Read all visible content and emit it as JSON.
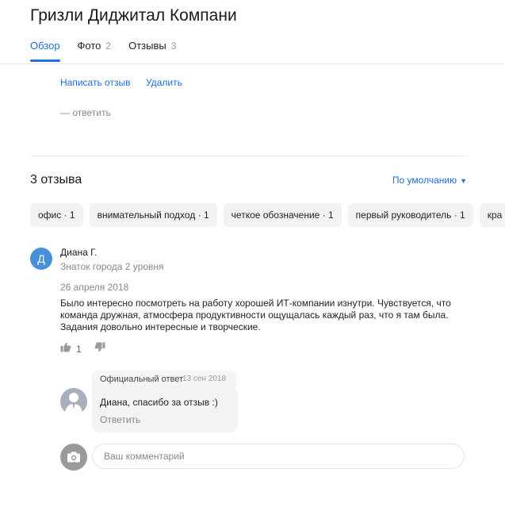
{
  "company": {
    "title": "Гризли Диджитал Компани"
  },
  "tabs": [
    {
      "label": "Обзор",
      "count": ""
    },
    {
      "label": "Фото",
      "count": "2"
    },
    {
      "label": "Отзывы",
      "count": "3"
    }
  ],
  "own_review": {
    "write_label": "Написать отзыв",
    "delete_label": "Удалить",
    "reply_label": "— ответить"
  },
  "reviews": {
    "title": "3 отзыва",
    "sort_label": "По умолчанию",
    "chips": [
      "офис · 1",
      "внимательный подход · 1",
      "четкое обозначение · 1",
      "первый руководитель · 1",
      "кра"
    ],
    "items": [
      {
        "avatar_letter": "Д",
        "author": "Диана Г.",
        "status": "Знаток города 2 уровня",
        "date": "26 апреля 2018",
        "text": "Было интересно посмотреть на работу хорошей ИТ-компании изнутри. Чувствуется, что команда дружная, атмосфера продуктивности ощущалась каждый раз, что я там была. Задания довольно интересные и творческие.",
        "likes": "1",
        "official_reply": {
          "label": "Официальный ответ",
          "date": "13 сен 2018",
          "text": "Диана, спасибо за отзыв :)",
          "answer_label": "Ответить"
        }
      }
    ]
  },
  "comment": {
    "placeholder": "Ваш комментарий"
  },
  "colors": {
    "accent": "#1e6fd9",
    "avatar": "#4a90d9",
    "chip_bg": "#f2f2f2"
  },
  "icons": {
    "like": "thumbs-up-icon",
    "dislike": "thumbs-down-icon",
    "camera": "camera-icon",
    "chevron": "chevron-down-icon",
    "company_avatar": "person-silhouette-icon"
  }
}
